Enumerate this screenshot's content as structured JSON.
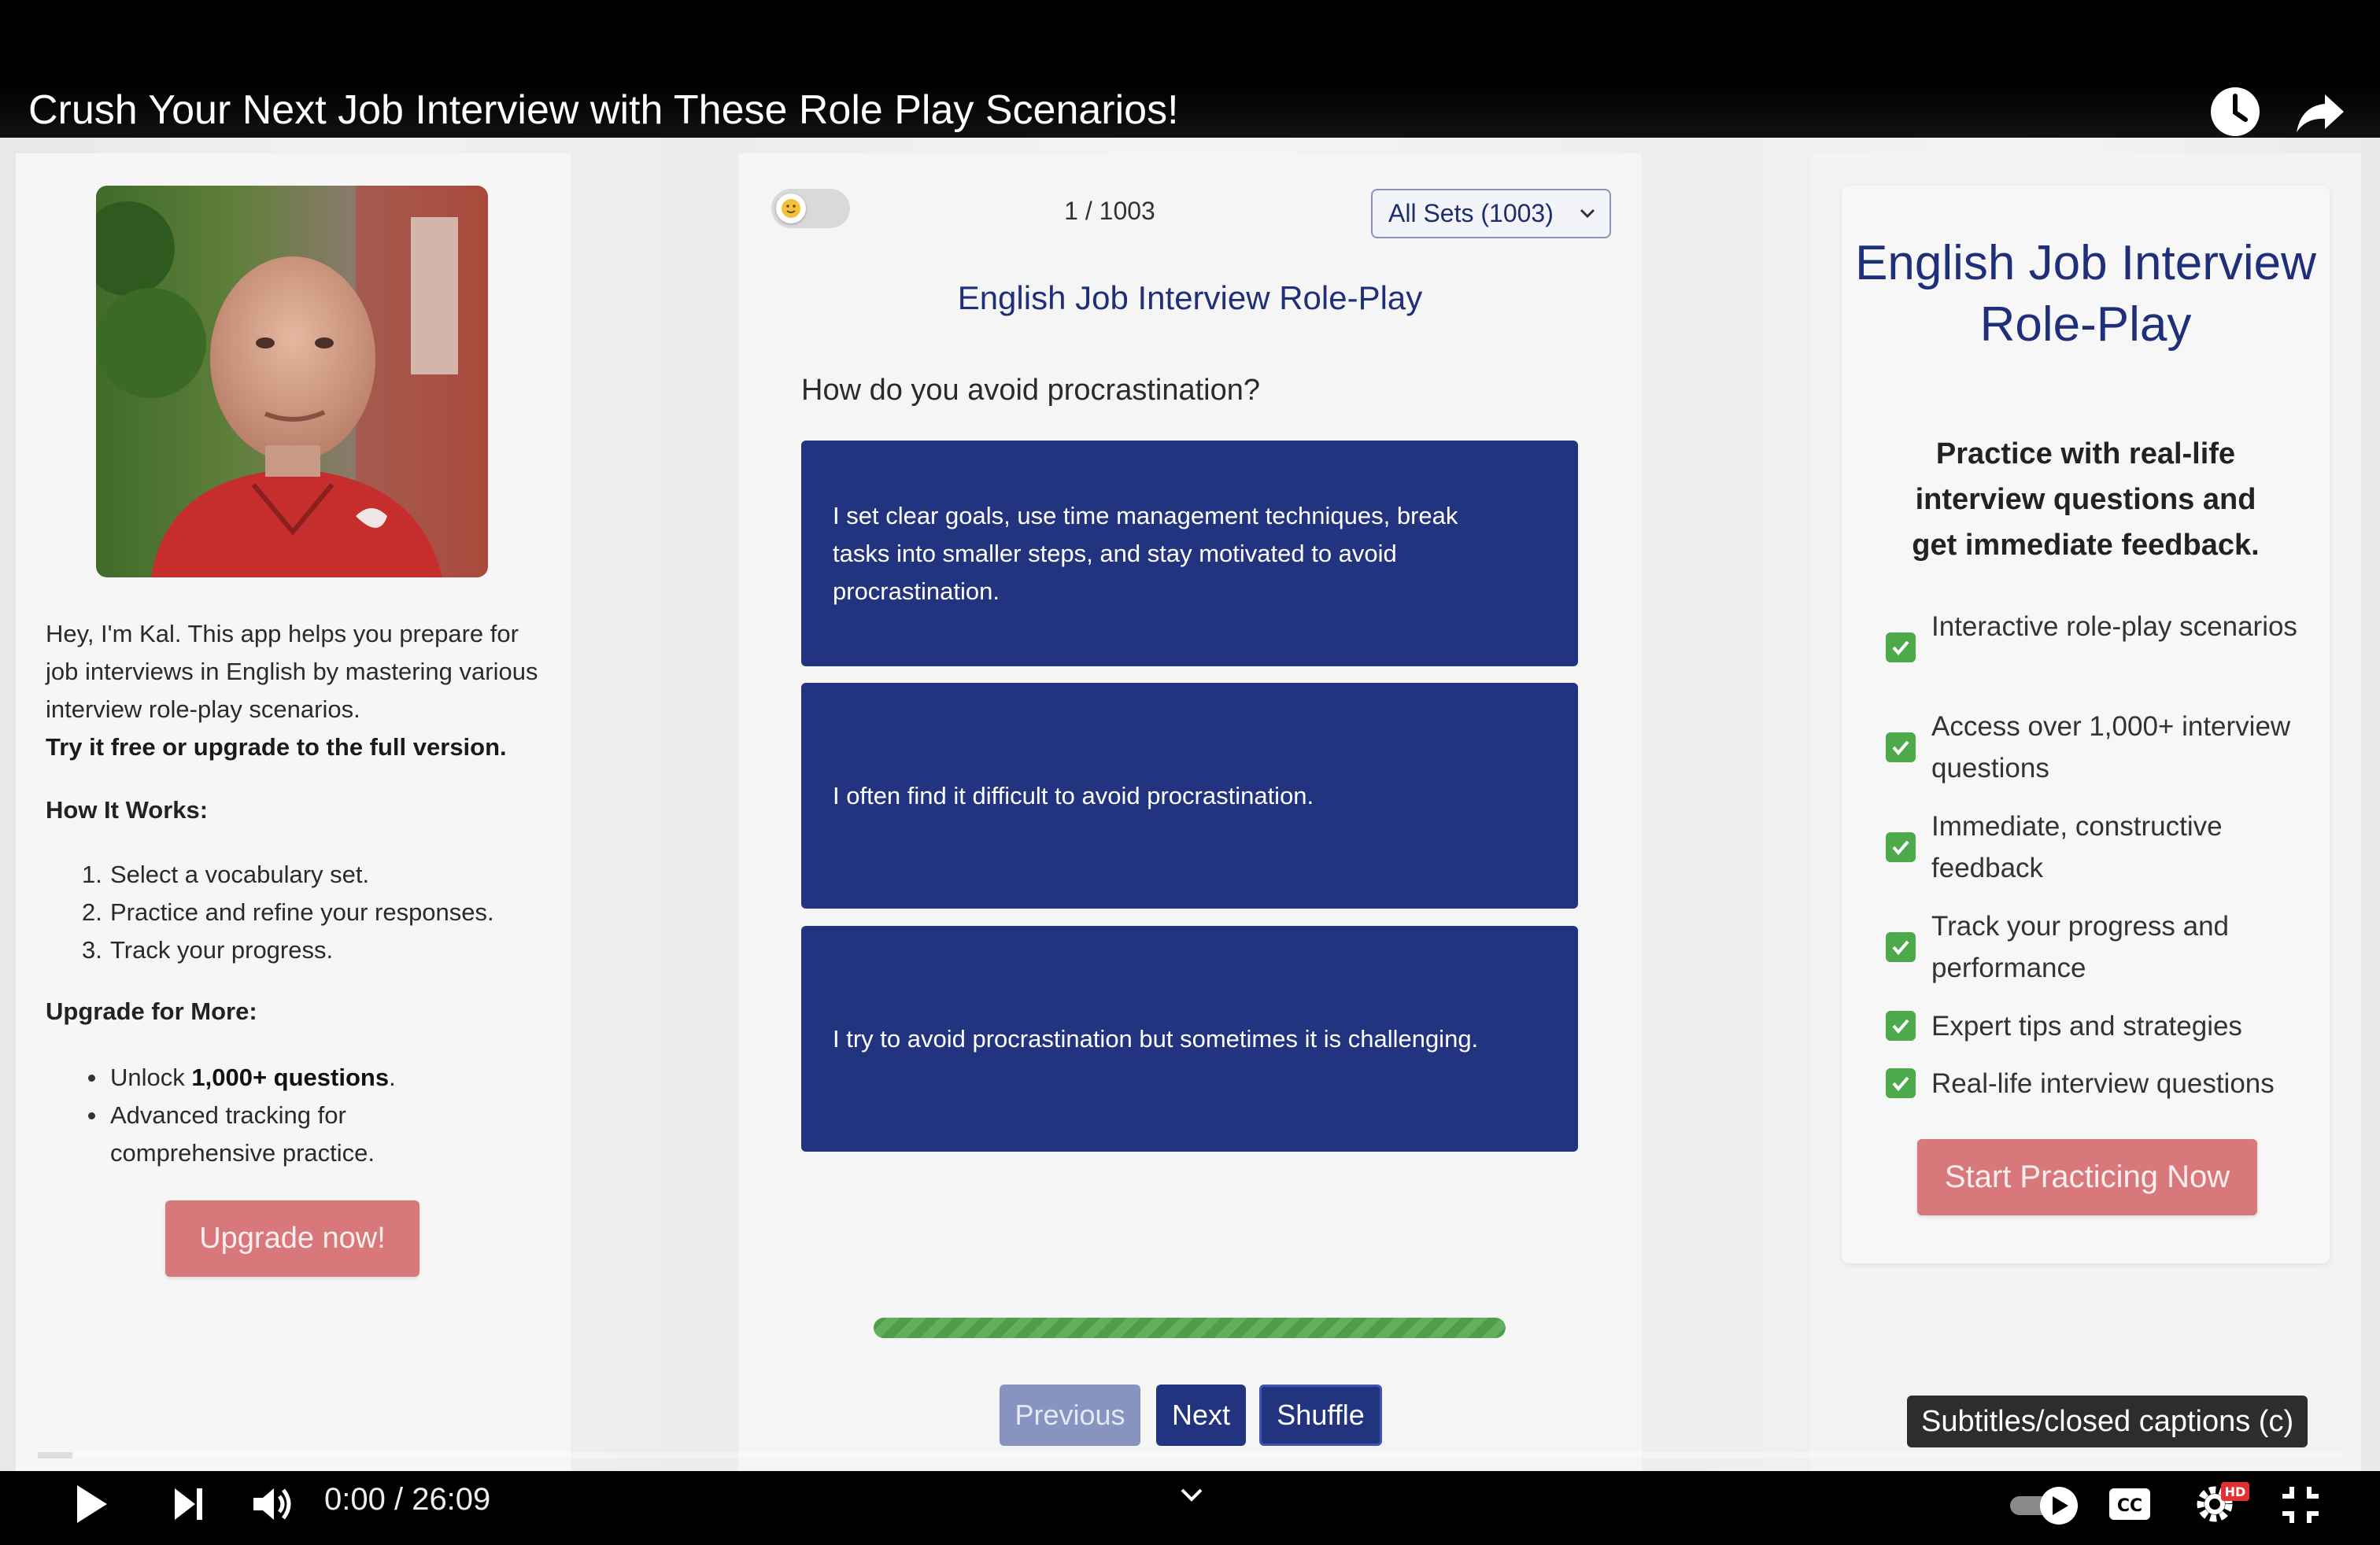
{
  "video": {
    "title": "Crush Your Next Job Interview with These Role Play Scenarios!",
    "time": "0:00 / 26:09",
    "tooltip": "Subtitles/closed captions (c)",
    "played_fraction": 0.015,
    "hd_badge": "HD"
  },
  "left": {
    "intro": "Hey, I'm Kal. This app helps you prepare for job interviews in English by mastering various interview role-play scenarios.",
    "intro_bold": "Try it free or upgrade to the full version.",
    "how_heading": "How It Works:",
    "steps": [
      {
        "num": "1.",
        "text": "Select a vocabulary set."
      },
      {
        "num": "2.",
        "text": "Practice and refine your responses."
      },
      {
        "num": "3.",
        "text": "Track your progress."
      }
    ],
    "upgrade_heading": "Upgrade for More:",
    "bullet1_pre": "Unlock ",
    "bullet1_bold": "1,000+ questions",
    "bullet1_post": ".",
    "bullet2": "Advanced tracking for comprehensive practice.",
    "upgrade_button": "Upgrade now!"
  },
  "center": {
    "counter": "1 / 1003",
    "select_value": "All Sets (1003)",
    "title": "English Job Interview Role-Play",
    "question": "How do you avoid procrastination?",
    "answers": [
      "I set clear goals, use time management techniques, break tasks into smaller steps, and stay motivated to avoid procrastination.",
      "I often find it difficult to avoid procrastination.",
      "I try to avoid procrastination but sometimes it is challenging."
    ],
    "progress_fraction": 1.0,
    "prev_label": "Previous",
    "next_label": "Next",
    "shuffle_label": "Shuffle"
  },
  "right": {
    "title": "English Job Interview Role-Play",
    "subtitle": "Practice with real-life interview questions and get immediate feedback.",
    "features": [
      "Interactive role-play scenarios",
      "Access over 1,000+ interview questions",
      "Immediate, constructive feedback",
      "Track your progress and performance",
      "Expert tips and strategies",
      "Real-life interview questions"
    ],
    "cta": "Start Practicing Now"
  },
  "colors": {
    "navy": "#22337f",
    "title_blue": "#1f2f7a",
    "salmon": "#d9787a",
    "green": "#4daa4a"
  }
}
